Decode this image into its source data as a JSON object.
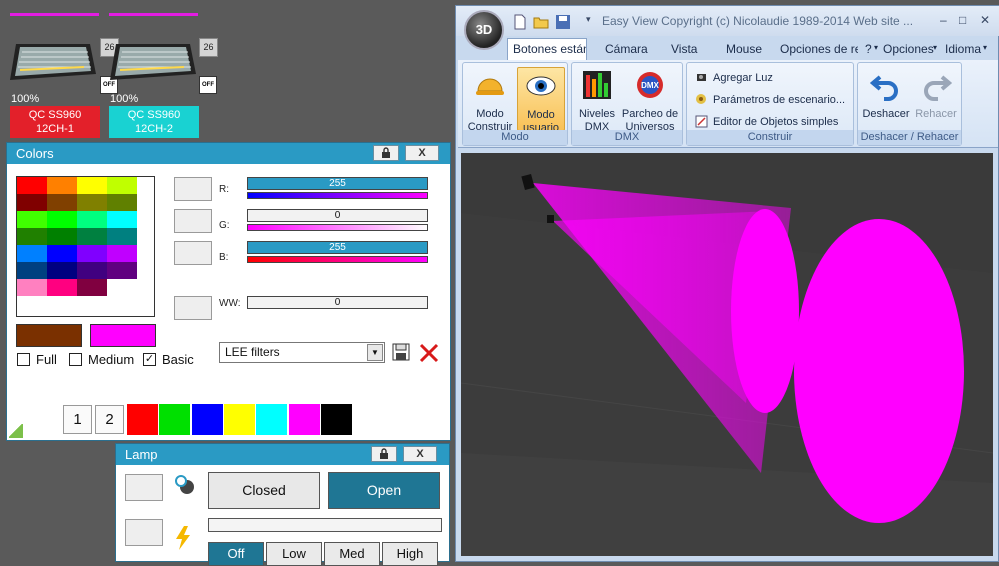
{
  "colors_hex": {
    "fixture_bar": "#e31ce3",
    "fixture1_label_bg": "#e3202a",
    "fixture2_label_bg": "#19d2d2",
    "panel_title": "#2a9ac4",
    "beam": "#ff00ff"
  },
  "fixtures": [
    {
      "channel": "26",
      "off_label": "OFF",
      "percent": "100%",
      "name_line1": "QC SS960",
      "name_line2": "12CH-1"
    },
    {
      "channel": "26",
      "off_label": "OFF",
      "percent": "100%",
      "name_line1": "QC SS960",
      "name_line2": "12CH-2"
    }
  ],
  "colors_panel": {
    "title": "Colors",
    "lock_icon": "lock-icon",
    "close_label": "X",
    "palette": [
      "#ff0000",
      "#ff8000",
      "#ffff00",
      "#c0ff00",
      "#800000",
      "#804000",
      "#808000",
      "#608000",
      "#40ff00",
      "#00ff00",
      "#00ff80",
      "#00ffff",
      "#208000",
      "#008000",
      "#008040",
      "#008080",
      "#0080ff",
      "#0000ff",
      "#8000ff",
      "#c000ff",
      "#004080",
      "#000080",
      "#400080",
      "#600080",
      "#ff80c0",
      "#ff0080",
      "#800040",
      "#ffffff"
    ],
    "channels": [
      {
        "label": "R:",
        "value": "255",
        "fill": 1.0
      },
      {
        "label": "G:",
        "value": "0",
        "fill": 0.0
      },
      {
        "label": "B:",
        "value": "255",
        "fill": 1.0
      },
      {
        "label": "WW:",
        "value": "0",
        "fill": 0.0
      }
    ],
    "preview_color_1": "#7a3000",
    "preview_color_2": "#ff00ff",
    "checks": [
      {
        "label": "Full",
        "checked": false
      },
      {
        "label": "Medium",
        "checked": false
      },
      {
        "label": "Basic",
        "checked": true
      }
    ],
    "filter_select": "LEE filters",
    "page_buttons": [
      "1",
      "2"
    ],
    "swatches": [
      "#ff0000",
      "#00e000",
      "#0000ff",
      "#ffff00",
      "#00ffff",
      "#ff00ff",
      "#000000"
    ]
  },
  "lamp_panel": {
    "title": "Lamp",
    "close_label": "X",
    "closed_label": "Closed",
    "open_label": "Open",
    "levels": [
      "Off",
      "Low",
      "Med",
      "High"
    ]
  },
  "app": {
    "orb_label": "3D",
    "title": "Easy View   Copyright (c) Nicolaudie 1989-2014   Web site ...",
    "window_controls": [
      "–",
      "□",
      "✕"
    ],
    "tabs": [
      "Botones estándar",
      "Cámara",
      "Vista",
      "Mouse",
      "Opciones de re",
      "?",
      "Opciones",
      "Idioma"
    ],
    "groups": {
      "modo": {
        "label": "Modo",
        "buttons": [
          "Modo\nConstruir",
          "Modo\nusuario"
        ]
      },
      "dmx": {
        "label": "DMX",
        "buttons": [
          "Niveles\nDMX",
          "Parcheo de\nUniversos"
        ]
      },
      "construir": {
        "label": "Construir",
        "items": [
          "Agregar Luz",
          "Parámetros de escenario...",
          "Editor de Objetos simples"
        ]
      },
      "deshacer": {
        "label": "Deshacer / Rehacer",
        "buttons": [
          "Deshacer",
          "Rehacer"
        ]
      }
    }
  }
}
